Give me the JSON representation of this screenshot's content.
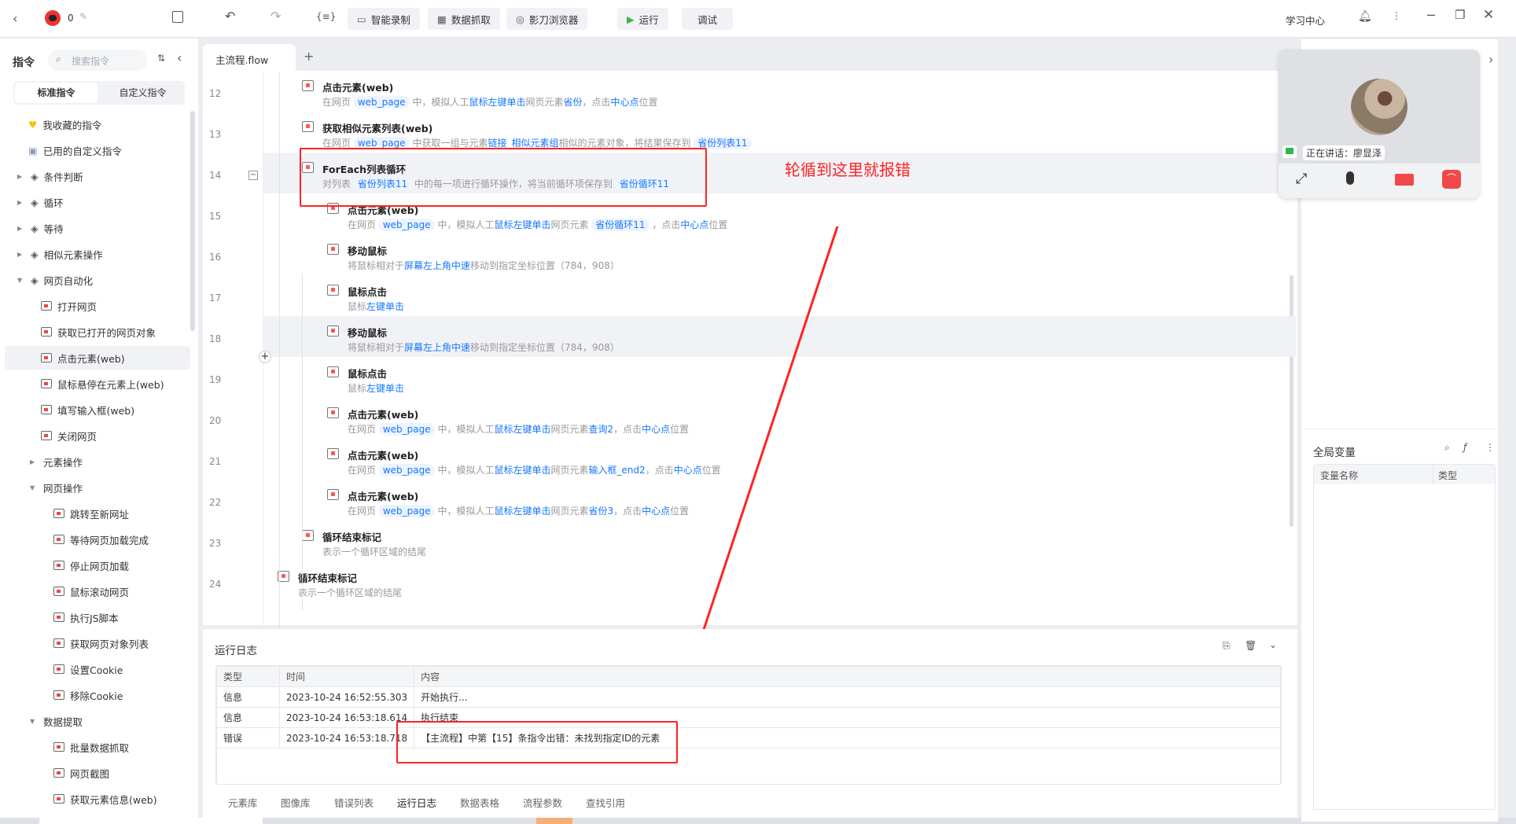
{
  "topbar": {
    "counter": "0",
    "buttons": {
      "record": "智能录制",
      "scrape": "数据抓取",
      "browser": "影刀浏览器",
      "run": "运行",
      "debug": "调试"
    },
    "learning": "学习中心"
  },
  "sidebar": {
    "title": "指令",
    "search_placeholder": "搜索指令",
    "tabs": [
      "标准指令",
      "自定义指令"
    ],
    "items": [
      {
        "label": "我收藏的指令",
        "level": 0,
        "kind": "heart"
      },
      {
        "label": "已用的自定义指令",
        "level": 0,
        "kind": "cal"
      },
      {
        "label": "条件判断",
        "level": 0,
        "kind": "group",
        "state": "collapsed"
      },
      {
        "label": "循环",
        "level": 0,
        "kind": "group",
        "state": "collapsed"
      },
      {
        "label": "等待",
        "level": 0,
        "kind": "group",
        "state": "collapsed"
      },
      {
        "label": "相似元素操作",
        "level": 0,
        "kind": "group",
        "state": "collapsed"
      },
      {
        "label": "网页自动化",
        "level": 0,
        "kind": "group",
        "state": "expanded"
      },
      {
        "label": "打开网页",
        "level": 1
      },
      {
        "label": "获取已打开的网页对象",
        "level": 1
      },
      {
        "label": "点击元素(web)",
        "level": 1,
        "selected": true
      },
      {
        "label": "鼠标悬停在元素上(web)",
        "level": 1
      },
      {
        "label": "填写输入框(web)",
        "level": 1
      },
      {
        "label": "关闭网页",
        "level": 1
      },
      {
        "label": "元素操作",
        "level": 1,
        "kind": "group",
        "state": "collapsed"
      },
      {
        "label": "网页操作",
        "level": 1,
        "kind": "group",
        "state": "expanded"
      },
      {
        "label": "跳转至新网址",
        "level": 2
      },
      {
        "label": "等待网页加载完成",
        "level": 2
      },
      {
        "label": "停止网页加载",
        "level": 2
      },
      {
        "label": "鼠标滚动网页",
        "level": 2
      },
      {
        "label": "执行JS脚本",
        "level": 2
      },
      {
        "label": "获取网页对象列表",
        "level": 2
      },
      {
        "label": "设置Cookie",
        "level": 2
      },
      {
        "label": "移除Cookie",
        "level": 2
      },
      {
        "label": "数据提取",
        "level": 1,
        "kind": "group",
        "state": "expanded"
      },
      {
        "label": "批量数据抓取",
        "level": 2
      },
      {
        "label": "网页截图",
        "level": 2
      },
      {
        "label": "获取元素信息(web)",
        "level": 2
      }
    ]
  },
  "editor": {
    "tab": "主流程.flow",
    "rows": [
      {
        "line": "12",
        "level": 1,
        "title": "点击元素(web)",
        "desc": [
          [
            "t",
            "在网页 "
          ],
          [
            "c",
            "web_page"
          ],
          [
            "t",
            " 中，模拟人工"
          ],
          [
            "l",
            "鼠标左键单击"
          ],
          [
            "t",
            "网页元素"
          ],
          [
            "l",
            "省份"
          ],
          [
            "t",
            "，点击"
          ],
          [
            "l",
            "中心点"
          ],
          [
            "t",
            "位置"
          ]
        ]
      },
      {
        "line": "13",
        "level": 1,
        "title": "获取相似元素列表(web)",
        "desc": [
          [
            "t",
            "在网页 "
          ],
          [
            "c",
            "web_page"
          ],
          [
            "t",
            " 中获取一组与元素"
          ],
          [
            "l",
            "链接_相似元素组"
          ],
          [
            "t",
            "相似的元素对象，将结果保存到 "
          ],
          [
            "c",
            "省份列表11"
          ]
        ]
      },
      {
        "line": "14",
        "level": 1,
        "title": "ForEach列表循环",
        "hl": true,
        "desc": [
          [
            "t",
            "对列表 "
          ],
          [
            "c",
            "省份列表11"
          ],
          [
            "t",
            " 中的每一项进行循环操作，将当前循环项保存到 "
          ],
          [
            "c",
            "省份循环11"
          ]
        ]
      },
      {
        "line": "15",
        "level": 2,
        "title": "点击元素(web)",
        "desc": [
          [
            "t",
            "在网页 "
          ],
          [
            "c",
            "web_page"
          ],
          [
            "t",
            " 中，模拟人工"
          ],
          [
            "l",
            "鼠标左键单击"
          ],
          [
            "t",
            "网页元素 "
          ],
          [
            "c",
            "省份循环11"
          ],
          [
            "t",
            " ，点击"
          ],
          [
            "l",
            "中心点"
          ],
          [
            "t",
            "位置"
          ]
        ]
      },
      {
        "line": "16",
        "level": 2,
        "title": "移动鼠标",
        "desc": [
          [
            "t",
            "将鼠标相对于"
          ],
          [
            "l",
            "屏幕左上角中速"
          ],
          [
            "t",
            "移动到指定坐标位置（784，908）"
          ]
        ]
      },
      {
        "line": "17",
        "level": 2,
        "title": "鼠标点击",
        "desc": [
          [
            "t",
            "鼠标"
          ],
          [
            "l",
            "左键单击"
          ]
        ]
      },
      {
        "line": "18",
        "level": 2,
        "title": "移动鼠标",
        "hl": true,
        "desc": [
          [
            "t",
            "将鼠标相对于"
          ],
          [
            "l",
            "屏幕左上角中速"
          ],
          [
            "t",
            "移动到指定坐标位置（784，908）"
          ]
        ]
      },
      {
        "line": "19",
        "level": 2,
        "title": "鼠标点击",
        "desc": [
          [
            "t",
            "鼠标"
          ],
          [
            "l",
            "左键单击"
          ]
        ]
      },
      {
        "line": "20",
        "level": 2,
        "title": "点击元素(web)",
        "desc": [
          [
            "t",
            "在网页 "
          ],
          [
            "c",
            "web_page"
          ],
          [
            "t",
            " 中，模拟人工"
          ],
          [
            "l",
            "鼠标左键单击"
          ],
          [
            "t",
            "网页元素"
          ],
          [
            "l",
            "查询2"
          ],
          [
            "t",
            "，点击"
          ],
          [
            "l",
            "中心点"
          ],
          [
            "t",
            "位置"
          ]
        ]
      },
      {
        "line": "21",
        "level": 2,
        "title": "点击元素(web)",
        "desc": [
          [
            "t",
            "在网页 "
          ],
          [
            "c",
            "web_page"
          ],
          [
            "t",
            " 中，模拟人工"
          ],
          [
            "l",
            "鼠标左键单击"
          ],
          [
            "t",
            "网页元素"
          ],
          [
            "l",
            "输入框_end2"
          ],
          [
            "t",
            "，点击"
          ],
          [
            "l",
            "中心点"
          ],
          [
            "t",
            "位置"
          ]
        ]
      },
      {
        "line": "22",
        "level": 2,
        "title": "点击元素(web)",
        "desc": [
          [
            "t",
            "在网页 "
          ],
          [
            "c",
            "web_page"
          ],
          [
            "t",
            " 中，模拟人工"
          ],
          [
            "l",
            "鼠标左键单击"
          ],
          [
            "t",
            "网页元素"
          ],
          [
            "l",
            "省份3"
          ],
          [
            "t",
            "，点击"
          ],
          [
            "l",
            "中心点"
          ],
          [
            "t",
            "位置"
          ]
        ]
      },
      {
        "line": "23",
        "level": 1,
        "title": "循环结束标记",
        "desc": [
          [
            "t",
            "表示一个循环区域的结尾"
          ]
        ]
      },
      {
        "line": "24",
        "level": 0,
        "title": "循环结束标记",
        "desc": [
          [
            "t",
            "表示一个循环区域的结尾"
          ]
        ]
      }
    ],
    "annotation": "轮循到这里就报错"
  },
  "log": {
    "title": "运行日志",
    "columns": [
      "类型",
      "时间",
      "内容"
    ],
    "rows": [
      [
        "信息",
        "2023-10-24 16:52:55.303",
        "开始执行..."
      ],
      [
        "信息",
        "2023-10-24 16:53:18.614",
        "执行结束"
      ],
      [
        "错误",
        "2023-10-24 16:53:18.718",
        "【主流程】中第【15】条指令出错：未找到指定ID的元素"
      ]
    ],
    "tabs": [
      "元素库",
      "图像库",
      "错误列表",
      "运行日志",
      "数据表格",
      "流程参数",
      "查找引用"
    ],
    "active_tab": "运行日志"
  },
  "video": {
    "speaking": "正在讲话：廖显泽"
  },
  "globals": {
    "title": "全局变量",
    "columns": [
      "变量名称",
      "类型"
    ]
  },
  "colors": {
    "accent": "#1677ff",
    "annotation": "#ff2222",
    "run": "#3cb44b"
  }
}
